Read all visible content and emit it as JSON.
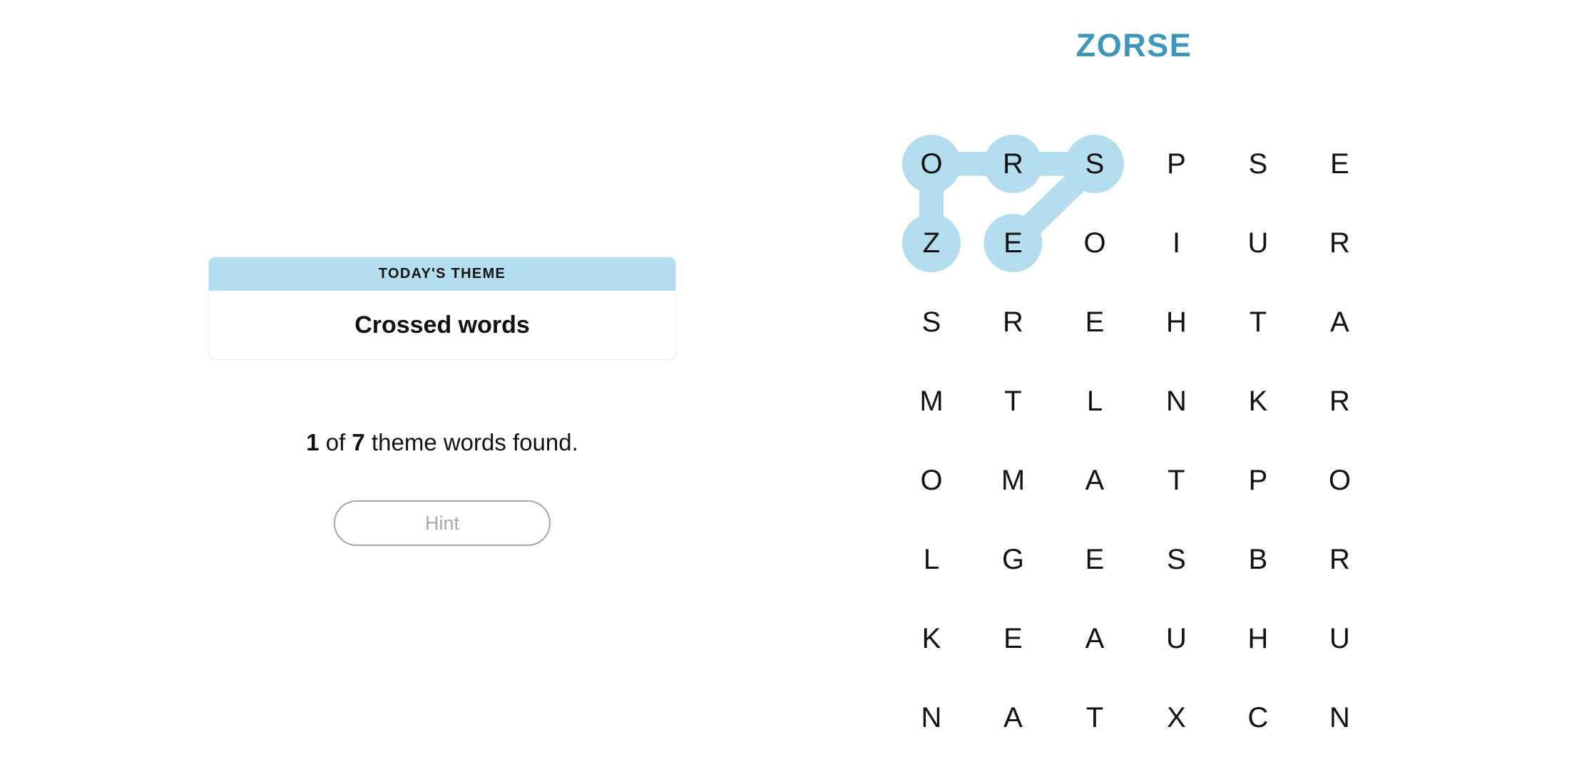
{
  "puzzle": {
    "title": "ZORSE",
    "title_color": "#3e96b8",
    "highlight_color": "#b4deed",
    "rows": 8,
    "cols": 6,
    "grid": [
      [
        "O",
        "R",
        "S",
        "P",
        "S",
        "E"
      ],
      [
        "Z",
        "E",
        "O",
        "I",
        "U",
        "R"
      ],
      [
        "S",
        "R",
        "E",
        "H",
        "T",
        "A"
      ],
      [
        "M",
        "T",
        "L",
        "N",
        "K",
        "R"
      ],
      [
        "O",
        "M",
        "A",
        "T",
        "P",
        "O"
      ],
      [
        "L",
        "G",
        "E",
        "S",
        "B",
        "R"
      ],
      [
        "K",
        "E",
        "A",
        "U",
        "H",
        "U"
      ],
      [
        "N",
        "A",
        "T",
        "X",
        "C",
        "N"
      ]
    ],
    "highlighted_cells": [
      {
        "row": 0,
        "col": 0,
        "letter": "O"
      },
      {
        "row": 0,
        "col": 1,
        "letter": "R"
      },
      {
        "row": 0,
        "col": 2,
        "letter": "S"
      },
      {
        "row": 1,
        "col": 0,
        "letter": "Z"
      },
      {
        "row": 1,
        "col": 1,
        "letter": "E"
      }
    ],
    "highlight_connectors": [
      {
        "from": {
          "row": 0,
          "col": 0
        },
        "to": {
          "row": 0,
          "col": 1
        },
        "orientation": "horizontal"
      },
      {
        "from": {
          "row": 0,
          "col": 1
        },
        "to": {
          "row": 0,
          "col": 2
        },
        "orientation": "horizontal"
      },
      {
        "from": {
          "row": 0,
          "col": 0
        },
        "to": {
          "row": 1,
          "col": 0
        },
        "orientation": "vertical"
      },
      {
        "from": {
          "row": 0,
          "col": 2
        },
        "to": {
          "row": 1,
          "col": 1
        },
        "orientation": "diagonal"
      }
    ],
    "found_words": [
      "ZORSE"
    ]
  },
  "theme_card": {
    "header_label": "TODAY'S THEME",
    "theme_value": "Crossed words",
    "header_background": "#b4deed"
  },
  "progress": {
    "found_count": "1",
    "connector_text_1": " of ",
    "total_count": "7",
    "connector_text_2": " theme words found."
  },
  "hint": {
    "label": "Hint",
    "enabled": false
  }
}
